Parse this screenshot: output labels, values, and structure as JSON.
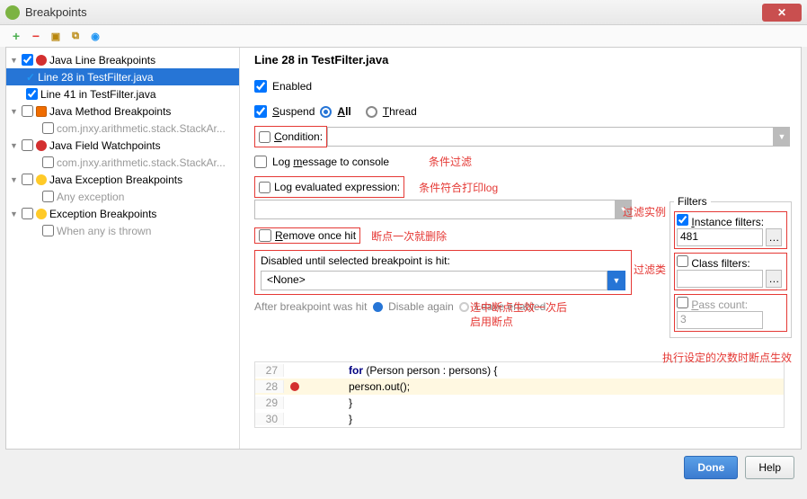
{
  "window": {
    "title": "Breakpoints"
  },
  "header": "Line 28 in TestFilter.java",
  "tree": {
    "g0": {
      "label": "Java Line Breakpoints",
      "c1": "Line 28 in TestFilter.java",
      "c2": "Line 41 in TestFilter.java"
    },
    "g1": {
      "label": "Java Method Breakpoints",
      "c1": "com.jnxy.arithmetic.stack.StackAr..."
    },
    "g2": {
      "label": "Java Field Watchpoints",
      "c1": "com.jnxy.arithmetic.stack.StackAr..."
    },
    "g3": {
      "label": "Java Exception Breakpoints",
      "c1": "Any exception"
    },
    "g4": {
      "label": "Exception Breakpoints",
      "c1": "When any is thrown"
    }
  },
  "opts": {
    "enabled": "Enabled",
    "suspend": "Suspend",
    "all": "All",
    "thread": "Thread",
    "condition": "Condition:",
    "logmsg": "Log message to console",
    "logeval": "Log evaluated expression:",
    "remove": "Remove once hit",
    "disabled_until": "Disabled until selected breakpoint is hit:",
    "none": "<None>",
    "after": "After breakpoint was hit",
    "dis_again": "Disable again",
    "leave_en": "Leave enabled"
  },
  "filters": {
    "legend": "Filters",
    "instance": "Instance filters:",
    "instance_val": "481",
    "class": "Class filters:",
    "pass": "Pass count:",
    "pass_val": "3"
  },
  "ann": {
    "a1": "条件过滤",
    "a2": "条件符合打印log",
    "a3": "断点一次就删除",
    "a4": "选中断点生效一次后",
    "a5": "启用断点",
    "a6": "过滤实例",
    "a7": "过滤类",
    "a8": "执行设定的次数时断点生效"
  },
  "code": {
    "l27": {
      "n": "27",
      "t": "for (Person person : persons) {"
    },
    "l28": {
      "n": "28",
      "t": "    person.out();"
    },
    "l29": {
      "n": "29",
      "t": "}"
    },
    "l30": {
      "n": "30",
      "t": "}"
    }
  },
  "buttons": {
    "done": "Done",
    "help": "Help"
  }
}
